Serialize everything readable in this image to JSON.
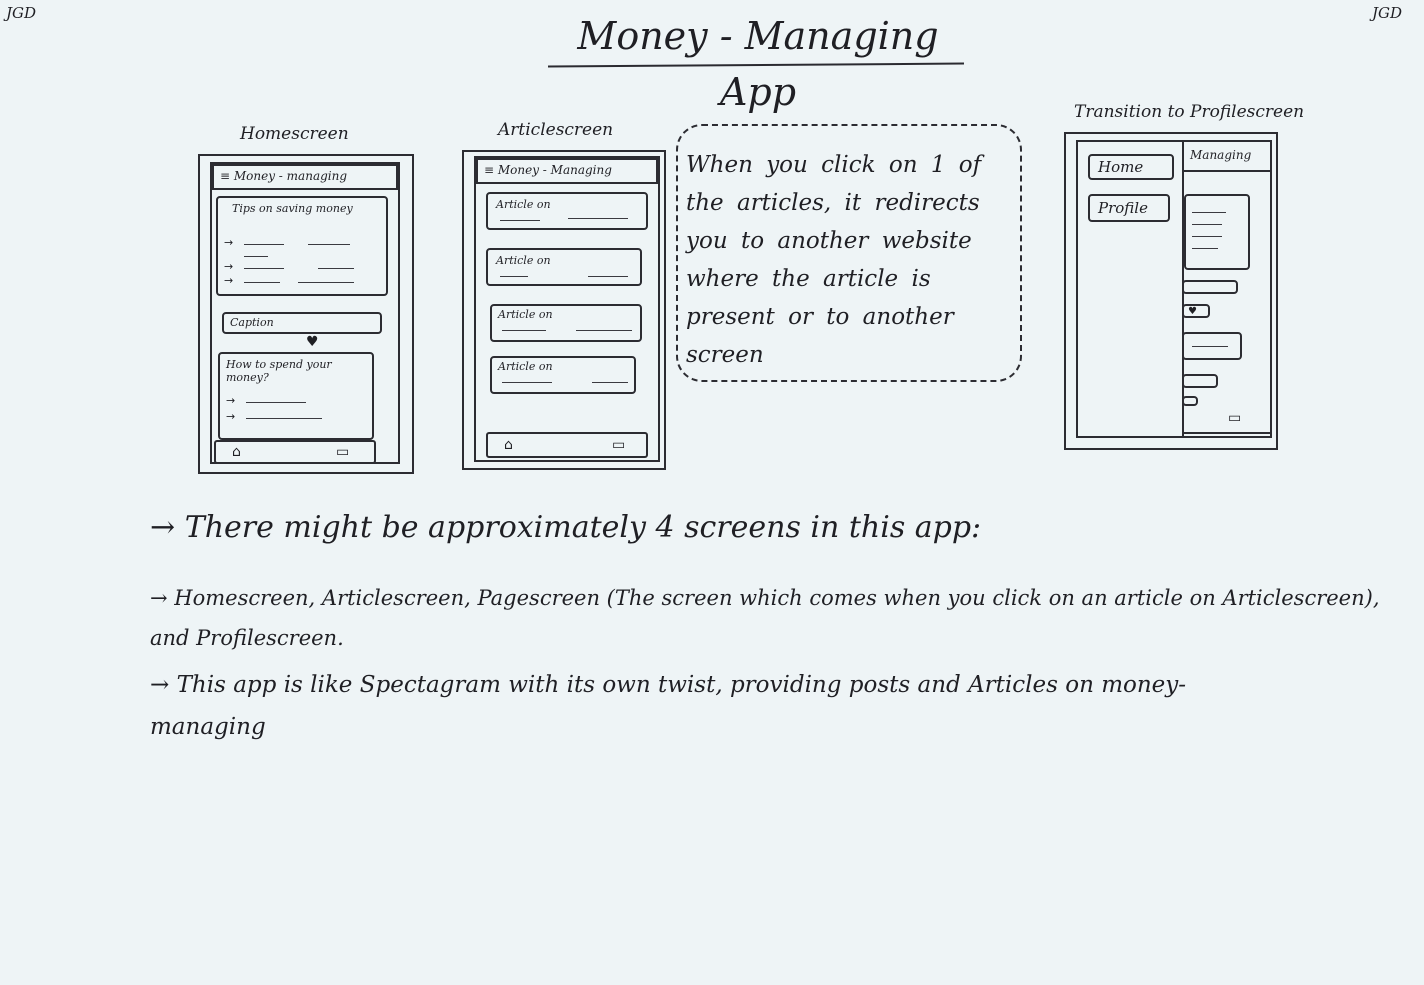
{
  "page": {
    "initials_left": "JGD",
    "initials_right": "JGD",
    "title": "Money - Managing App"
  },
  "sketches": {
    "homescreen": {
      "label": "Homescreen",
      "header": "Money - managing",
      "card1_title": "Tips on saving money",
      "caption_label": "Caption",
      "card2_title": "How to spend your money?",
      "nav_left_icon": "home-icon",
      "nav_right_icon": "menu-icon"
    },
    "articlescreen": {
      "label": "Articlescreen",
      "header": "Money - Managing",
      "articles": [
        "Article on",
        "Article on",
        "Article on",
        "Article on"
      ],
      "nav_left_icon": "home-icon",
      "nav_right_icon": "menu-icon"
    },
    "profile": {
      "label": "Transition to Profilescreen",
      "menu_home": "Home",
      "menu_profile": "Profile",
      "header": "Managing"
    }
  },
  "note": {
    "text": "When you click on 1 of the articles, it redirects you to another website where the article is present or to another screen"
  },
  "notes": [
    "There might be approximately 4 screens in this app:",
    "Homescreen, Articlescreen, Pagescreen (The screen which comes when you click on an article on Articlescreen), and Profilescreen.",
    "This app is like Spectagram with its own twist, providing posts and Articles on money-managing"
  ],
  "bullet": "→"
}
